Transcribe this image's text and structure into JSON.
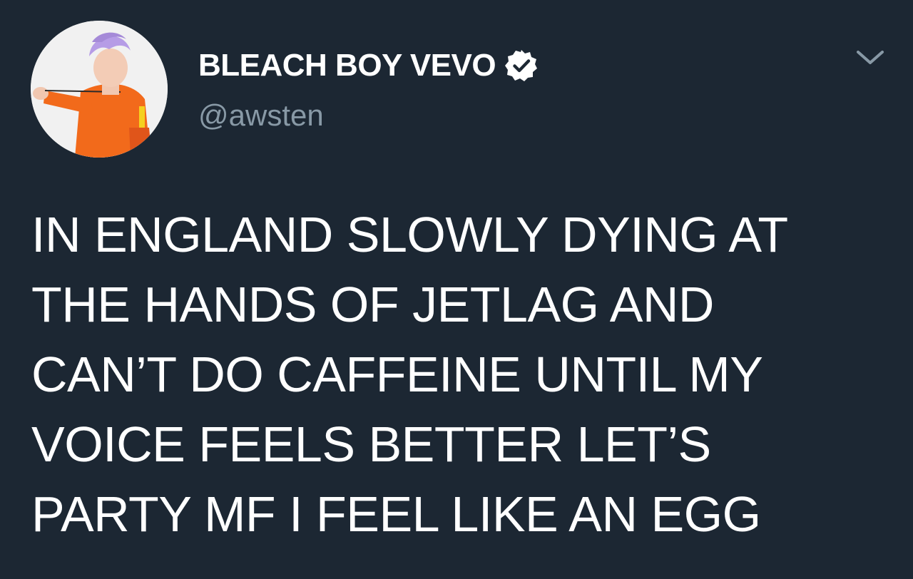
{
  "tweet": {
    "author": {
      "display_name": "BLEACH BOY VEVO",
      "handle": "@awsten",
      "verified": true,
      "avatar_icon": "profile-photo-avatar"
    },
    "menu_icon": "chevron-down-icon",
    "text_lines": [
      "IN ENGLAND SLOWLY DYING AT",
      "THE HANDS OF JETLAG AND",
      "CAN’T DO CAFFEINE UNTIL MY",
      "VOICE FEELS BETTER LET’S",
      "PARTY MF I FEEL LIKE AN EGG"
    ]
  },
  "colors": {
    "background": "#1c2733",
    "primary_text": "#ffffff",
    "secondary_text": "#8899a6",
    "chevron": "#8899a6",
    "verified_badge": "#ffffff"
  }
}
